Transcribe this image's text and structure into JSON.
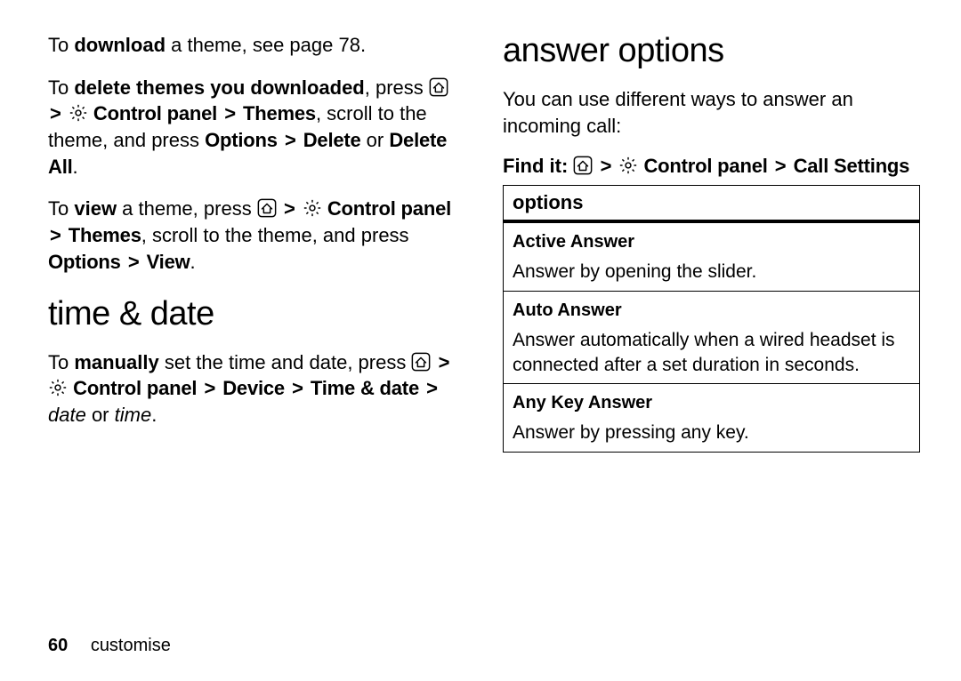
{
  "left": {
    "p1": {
      "pre": "To ",
      "bold": "download",
      "post": " a theme, see page 78."
    },
    "p2": {
      "pre": "To ",
      "bold": "delete themes you downloaded",
      "post1": ", press ",
      "path1": "Control panel",
      "gt1": ">",
      "path2": "Themes",
      "mid": ", scroll to the theme, and press ",
      "path3": "Options",
      "gt2": ">",
      "path4": "Delete",
      "or": " or ",
      "path5": "Delete All",
      "end": "."
    },
    "p3": {
      "pre": "To ",
      "bold": "view",
      "post1": " a theme, press ",
      "gt1": ">",
      "path1": "Control panel",
      "gt2": ">",
      "path2": "Themes",
      "mid": ", scroll to the theme, and press ",
      "path3": "Options",
      "gt3": ">",
      "path4": "View",
      "end": "."
    },
    "h2": "time & date",
    "p4": {
      "pre": "To ",
      "bold": "manually",
      "post1": " set the time and date, press ",
      "gt1": ">",
      "path1": "Control panel",
      "gt2": ">",
      "path2": "Device",
      "gt3": ">",
      "path3": "Time & date",
      "gt4": ">",
      "ital1": "date",
      "or": " or ",
      "ital2": "time",
      "end": "."
    }
  },
  "right": {
    "h2": "answer options",
    "intro": "You can use different ways to answer an incoming call:",
    "findit": {
      "label": "Find it:",
      "gt1": ">",
      "path1": "Control panel",
      "gt2": ">",
      "path2": "Call Settings"
    },
    "table": {
      "header": "options",
      "rows": [
        {
          "title": "Active Answer",
          "desc": "Answer by opening the slider."
        },
        {
          "title": "Auto Answer",
          "desc": "Answer automatically when a wired headset is connected after a set duration in seconds."
        },
        {
          "title": "Any Key Answer",
          "desc": "Answer by pressing any key."
        }
      ]
    }
  },
  "footer": {
    "page": "60",
    "section": "customise"
  }
}
